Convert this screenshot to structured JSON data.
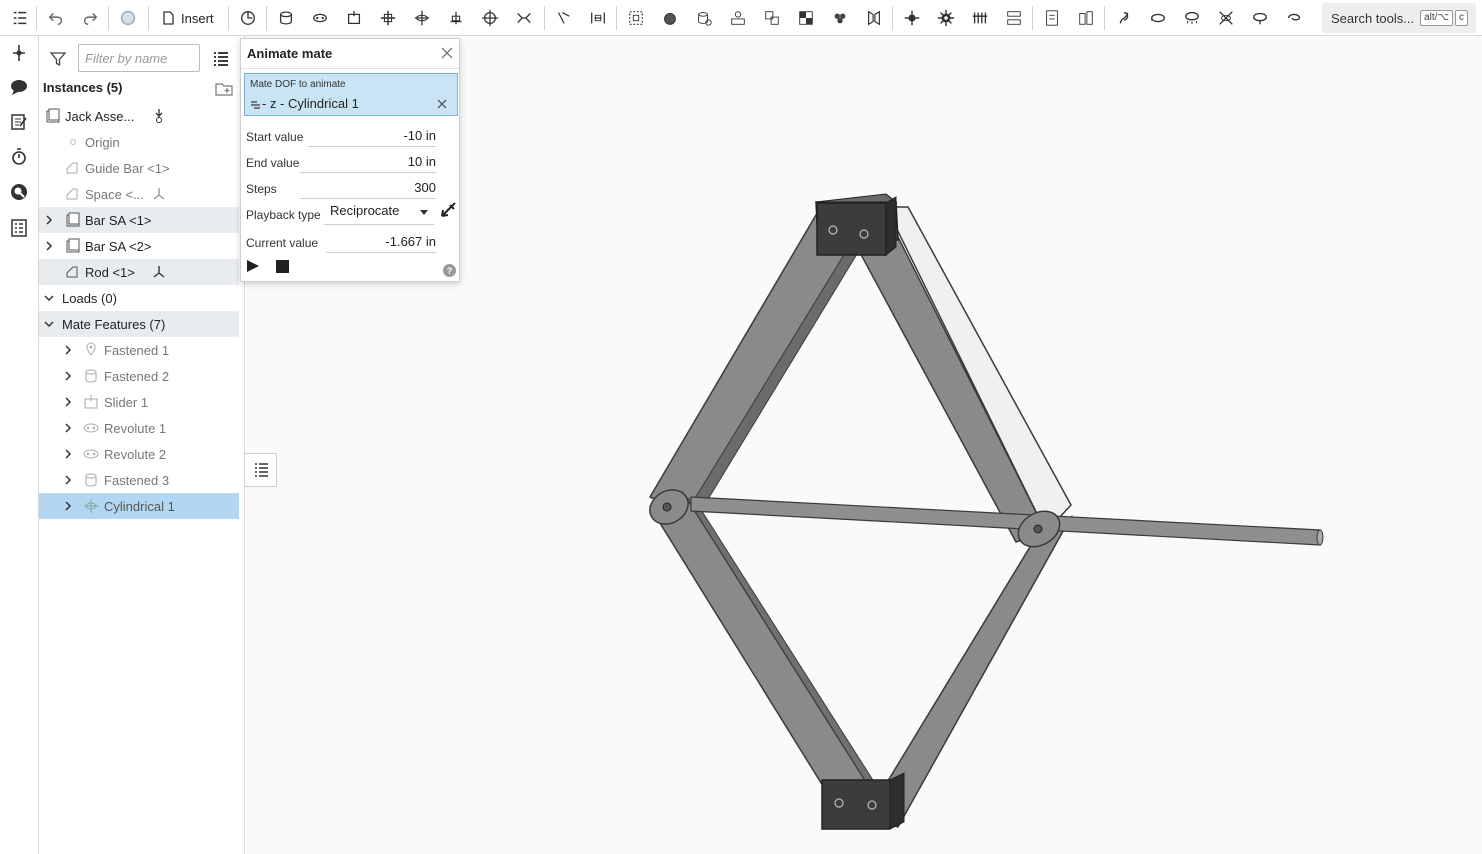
{
  "toolbar": {
    "insert_label": "Insert",
    "search_placeholder": "Search tools...",
    "search_shortcut": [
      "alt/⌥",
      "c"
    ]
  },
  "panel": {
    "filter_placeholder": "Filter by name",
    "instances_header": "Instances (5)",
    "instances": [
      {
        "label": "Jack Asse...",
        "state": "normal"
      },
      {
        "label": "Origin",
        "state": "dim"
      },
      {
        "label": "Guide Bar <1>",
        "state": "dim"
      },
      {
        "label": "Space <...",
        "state": "dim"
      },
      {
        "label": "Bar SA <1>",
        "state": "selected-gray"
      },
      {
        "label": "Bar SA <2>",
        "state": "normal"
      },
      {
        "label": "Rod <1>",
        "state": "selected-gray"
      }
    ],
    "loads_header": "Loads (0)",
    "mate_features_header": "Mate Features (7)",
    "mate_features": [
      {
        "label": "Fastened 1",
        "icon": "fastened-icon"
      },
      {
        "label": "Fastened 2",
        "icon": "fastened-icon"
      },
      {
        "label": "Slider 1",
        "icon": "slider-icon"
      },
      {
        "label": "Revolute 1",
        "icon": "revolute-icon"
      },
      {
        "label": "Revolute 2",
        "icon": "revolute-icon"
      },
      {
        "label": "Fastened 3",
        "icon": "fastened-icon"
      },
      {
        "label": "Cylindrical 1",
        "icon": "cylindrical-icon",
        "selected": true
      }
    ]
  },
  "dialog": {
    "title": "Animate mate",
    "dof_label": "Mate DOF to animate",
    "dof_value": "- z - Cylindrical 1",
    "fields": {
      "start_label": "Start value",
      "start_value": "-10 in",
      "end_label": "End value",
      "end_value": "10 in",
      "steps_label": "Steps",
      "steps_value": "300",
      "playback_label": "Playback type",
      "playback_value": "Reciprocate",
      "current_label": "Current value",
      "current_value": "-1.667 in"
    }
  },
  "colors": {
    "selection_blue": "#b3d7f2",
    "selection_gray": "#e9ecef",
    "part_gray": "#8a8a8a",
    "part_dark": "#3c3c3c"
  }
}
